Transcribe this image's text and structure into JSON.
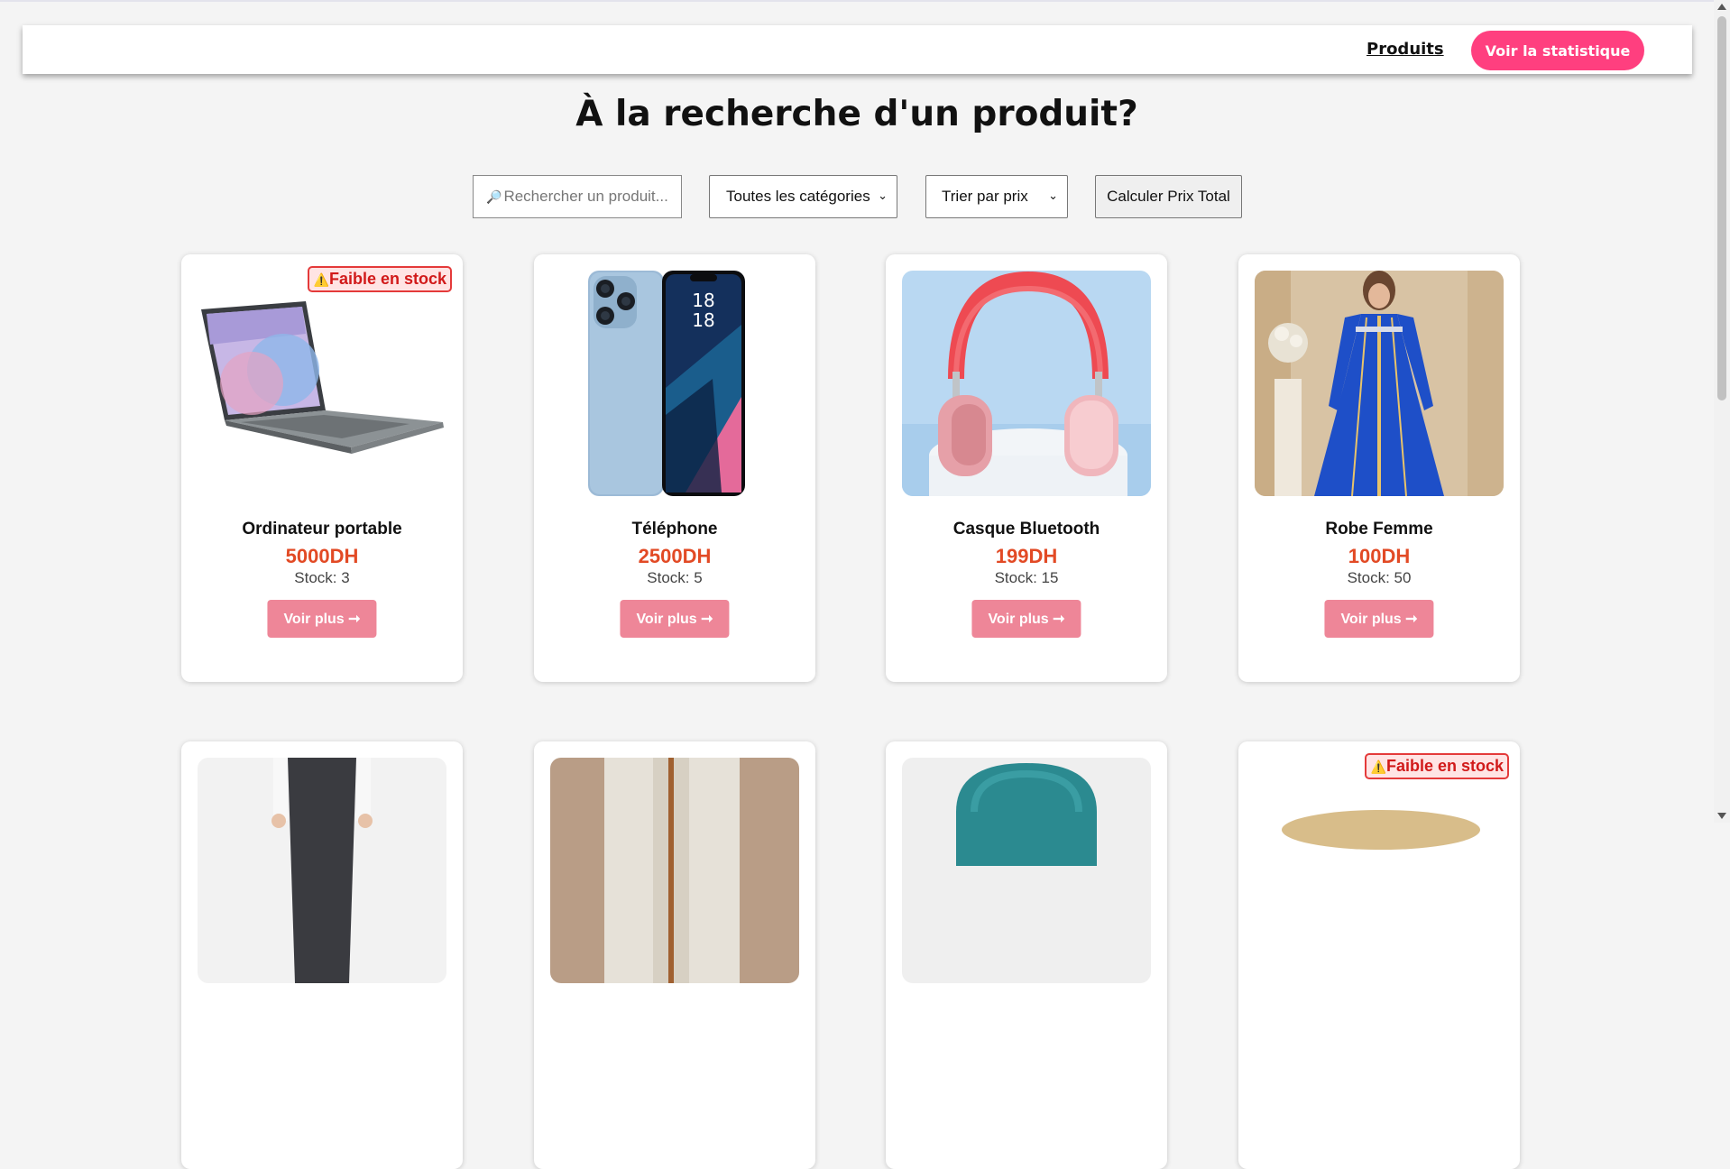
{
  "nav": {
    "link_label": "Produits",
    "stat_button_label": "Voir la statistique"
  },
  "page_title": "À la recherche d'un produit?",
  "filters": {
    "search_icon": "🔎",
    "search_placeholder": "Rechercher un produit...",
    "category_selected": "Toutes les catégories",
    "sort_selected": "Trier par prix",
    "calc_label": "Calculer Prix Total"
  },
  "low_stock_label": "Faible en stock",
  "warning_glyph": "⚠️",
  "more_label": "Voir plus ➞",
  "products": [
    {
      "name": "Ordinateur portable",
      "price": "5000DH",
      "stock": "Stock: 3",
      "low_stock": true,
      "image": "laptop"
    },
    {
      "name": "Téléphone",
      "price": "2500DH",
      "stock": "Stock: 5",
      "low_stock": false,
      "image": "phone"
    },
    {
      "name": "Casque Bluetooth",
      "price": "199DH",
      "stock": "Stock: 15",
      "low_stock": false,
      "image": "headphones"
    },
    {
      "name": "Robe Femme",
      "price": "100DH",
      "stock": "Stock: 50",
      "low_stock": false,
      "image": "dress"
    },
    {
      "name": "",
      "price": "",
      "stock": "",
      "low_stock": false,
      "image": "trousers"
    },
    {
      "name": "",
      "price": "",
      "stock": "",
      "low_stock": false,
      "image": "coat"
    },
    {
      "name": "",
      "price": "",
      "stock": "",
      "low_stock": false,
      "image": "chair"
    },
    {
      "name": "",
      "price": "",
      "stock": "",
      "low_stock": true,
      "image": "table"
    }
  ],
  "colors": {
    "accent": "#ff3f7f",
    "price": "#e24a25",
    "more_button": "#ee8698",
    "badge_border": "#e43a3a"
  }
}
